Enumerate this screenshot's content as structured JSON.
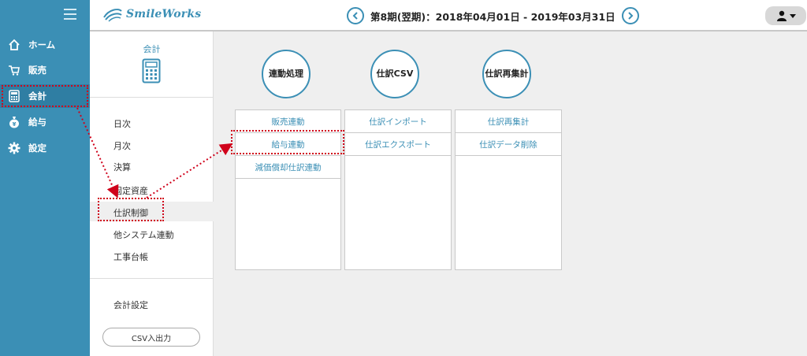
{
  "sidebar": {
    "items": [
      {
        "label": "ホーム",
        "icon": "home-icon"
      },
      {
        "label": "販売",
        "icon": "cart-icon"
      },
      {
        "label": "会計",
        "icon": "calculator-icon"
      },
      {
        "label": "給与",
        "icon": "money-bag-icon"
      },
      {
        "label": "設定",
        "icon": "gear-icon"
      }
    ],
    "active": "会計"
  },
  "header": {
    "logo": "SmileWorks",
    "period": "第8期(翌期)：2018年04月01日 - 2019年03月31日"
  },
  "submenu": {
    "title": "会計",
    "items": [
      "日次",
      "月次",
      "決算",
      "固定資産",
      "仕訳制御",
      "他システム連動",
      "工事台帳"
    ],
    "settings": "会計設定",
    "csv_button": "CSV入出力",
    "selected": "仕訳制御"
  },
  "content": {
    "columns": [
      {
        "title": "連動処理",
        "rows": [
          "販売連動",
          "給与連動",
          "減価償却仕訳連動"
        ]
      },
      {
        "title": "仕訳CSV",
        "rows": [
          "仕訳インポート",
          "仕訳エクスポート"
        ]
      },
      {
        "title_line1": "仕訳",
        "title_line2": "再集計",
        "rows": [
          "仕訳再集計",
          "仕訳データ削除"
        ]
      }
    ]
  },
  "colors": {
    "accent": "#3b8fb5",
    "highlight": "#d0021b"
  }
}
